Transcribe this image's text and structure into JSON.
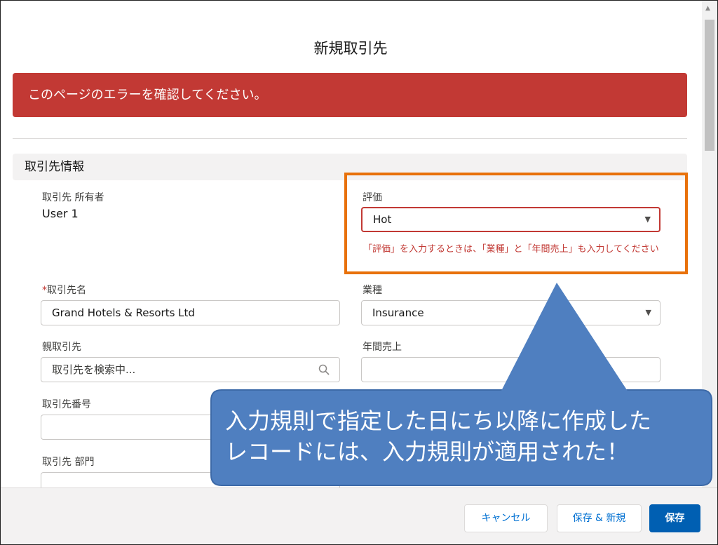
{
  "dialog": {
    "title": "新規取引先"
  },
  "error_banner": {
    "text": "このページのエラーを確認してください。"
  },
  "section": {
    "title": "取引先情報"
  },
  "fields": {
    "owner": {
      "label": "取引先 所有者",
      "value": "User 1"
    },
    "rating": {
      "label": "評価",
      "value": "Hot",
      "error": "「評価」を入力するときは、「業種」と「年間売上」も入力してください"
    },
    "account_name": {
      "required_mark": "*",
      "label": "取引先名",
      "value": "Grand Hotels & Resorts Ltd"
    },
    "industry": {
      "label": "業種",
      "value": "Insurance"
    },
    "parent_account": {
      "label": "親取引先",
      "placeholder": "取引先を検索中..."
    },
    "annual_revenue": {
      "label": "年間売上",
      "value": ""
    },
    "account_number": {
      "label": "取引先番号",
      "value": ""
    },
    "department": {
      "label": "取引先 部門",
      "value": ""
    }
  },
  "footer": {
    "cancel_label": "キャンセル",
    "save_new_label": "保存 & 新規",
    "save_label": "保存"
  },
  "callout": {
    "line1": "入力規則で指定した日にち以降に作成した",
    "line2": "レコードには、入力規則が適用された！"
  },
  "colors": {
    "error": "#c23934",
    "highlight": "#e8710a",
    "callout": "#4f7fc0",
    "brand": "#005fb2"
  },
  "icons": {
    "dropdown": "chevron-down-icon",
    "search": "search-icon"
  }
}
